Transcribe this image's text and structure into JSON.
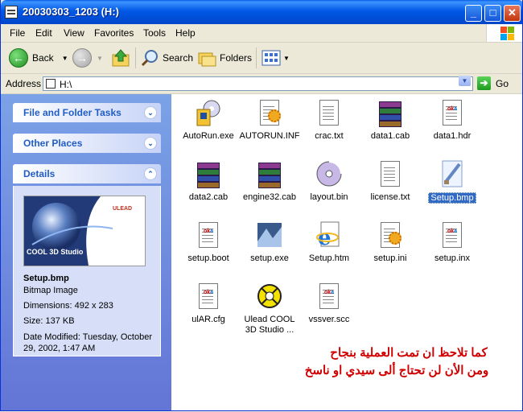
{
  "window": {
    "title": "20030303_1203 (H:)"
  },
  "menu": [
    "File",
    "Edit",
    "View",
    "Favorites",
    "Tools",
    "Help"
  ],
  "toolbar": {
    "back": "Back",
    "search": "Search",
    "folders": "Folders"
  },
  "address": {
    "label": "Address",
    "value": "H:\\",
    "go": "Go"
  },
  "sidebar": {
    "file_tasks": "File and Folder Tasks",
    "other_places": "Other Places",
    "details": "Details",
    "thumb_brand": "ULEAD",
    "thumb_product": "COOL 3D Studio",
    "file_name": "Setup.bmp",
    "file_type": "Bitmap Image",
    "dimensions": "Dimensions: 492 x 283",
    "size": "Size: 137 KB",
    "date_modified": "Date Modified: Tuesday, October 29, 2002, 1:47 AM"
  },
  "files": [
    {
      "name": "AutoRun.exe",
      "icon": "autorun-exe-icon"
    },
    {
      "name": "AUTORUN.INF",
      "icon": "settings-file-icon"
    },
    {
      "name": "crac.txt",
      "icon": "text-file-icon"
    },
    {
      "name": "data1.cab",
      "icon": "archive-icon"
    },
    {
      "name": "data1.hdr",
      "icon": "generic-file-icon"
    },
    {
      "name": "data2.cab",
      "icon": "archive-icon"
    },
    {
      "name": "engine32.cab",
      "icon": "archive-icon"
    },
    {
      "name": "layout.bin",
      "icon": "disc-icon"
    },
    {
      "name": "license.txt",
      "icon": "text-file-icon"
    },
    {
      "name": "Setup.bmp",
      "icon": "bitmap-icon",
      "selected": true
    },
    {
      "name": "setup.boot",
      "icon": "generic-file-icon"
    },
    {
      "name": "setup.exe",
      "icon": "setup-exe-icon"
    },
    {
      "name": "Setup.htm",
      "icon": "ie-html-icon"
    },
    {
      "name": "setup.ini",
      "icon": "settings-file-icon"
    },
    {
      "name": "setup.inx",
      "icon": "generic-file-icon"
    },
    {
      "name": "ulAR.cfg",
      "icon": "generic-file-icon"
    },
    {
      "name": "Ulead COOL 3D Studio ...",
      "icon": "ulead-exe-icon"
    },
    {
      "name": "vssver.scc",
      "icon": "generic-file-icon"
    }
  ],
  "overlay": {
    "line1": "كما تلاحظ ان تمت العملية بنجاح",
    "line2": "ومن الأن لن تحتاج ألى سيدي  او ناسخ"
  }
}
